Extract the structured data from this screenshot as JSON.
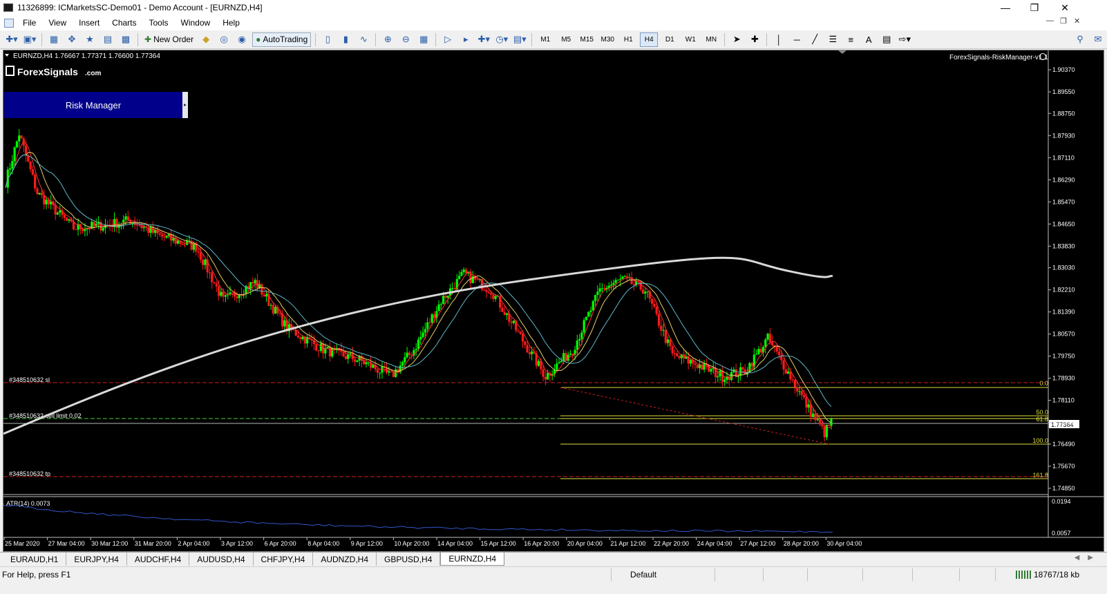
{
  "window": {
    "title": "11326899: ICMarketsSC-Demo01 - Demo Account - [EURNZD,H4]"
  },
  "menu": [
    "File",
    "View",
    "Insert",
    "Charts",
    "Tools",
    "Window",
    "Help"
  ],
  "toolbar": {
    "new_order": "New Order",
    "autotrading": "AutoTrading",
    "timeframes": [
      "M1",
      "M5",
      "M15",
      "M30",
      "H1",
      "H4",
      "D1",
      "W1",
      "MN"
    ],
    "active_timeframe": "H4"
  },
  "chart": {
    "header": "EURNZD,H4  1.76667 1.77371 1.76600 1.77364",
    "logo_text": "ForexSignals",
    "logo_suffix": ".com",
    "risk_manager_label": "Risk Manager",
    "ea_label": "ForexSignals-RiskManager-v1.1",
    "current_price": "1.77364",
    "price_labels": [
      "1.90370",
      "1.89550",
      "1.88750",
      "1.87930",
      "1.87110",
      "1.86290",
      "1.85470",
      "1.84650",
      "1.83830",
      "1.83030",
      "1.82210",
      "1.81390",
      "1.80570",
      "1.79750",
      "1.78930",
      "1.78110",
      "1.77290",
      "1.76490",
      "1.75670",
      "1.74850"
    ],
    "time_labels": [
      "25 Mar 2020",
      "27 Mar 04:00",
      "30 Mar 12:00",
      "31 Mar 20:00",
      "2 Apr 04:00",
      "3 Apr 12:00",
      "6 Apr 20:00",
      "8 Apr 04:00",
      "9 Apr 12:00",
      "10 Apr 20:00",
      "14 Apr 04:00",
      "15 Apr 12:00",
      "16 Apr 20:00",
      "20 Apr 04:00",
      "21 Apr 12:00",
      "22 Apr 20:00",
      "24 Apr 04:00",
      "27 Apr 12:00",
      "28 Apr 20:00",
      "30 Apr 04:00"
    ],
    "order_lines": {
      "sl": "#348510632 sl",
      "sell_limit": "#348510632 sell limit 0.02",
      "tp": "#348510632 tp"
    },
    "fib_labels": [
      "0.0",
      "50.0",
      "61.8",
      "100.0",
      "161.8"
    ],
    "atr_label": "ATR(14) 0.0073",
    "atr_scale": [
      "0.0194",
      "0.0057"
    ]
  },
  "tabs": [
    "EURAUD,H1",
    "EURJPY,H4",
    "AUDCHF,H4",
    "AUDUSD,H4",
    "CHFJPY,H4",
    "AUDNZD,H4",
    "GBPUSD,H4",
    "EURNZD,H4"
  ],
  "active_tab": "EURNZD,H4",
  "status": {
    "help": "For Help, press F1",
    "profile": "Default",
    "traffic": "18767/18 kb"
  },
  "colors": {
    "bull": "#00ff00",
    "bear": "#ff1a1a",
    "ma_long": "#d9d9d9",
    "ma_fast": "#ff3333",
    "ma_mid": "#e8d06a",
    "ma_slow": "#5fb8c8",
    "order_line": "#d02020",
    "fib": "#e0e040",
    "atr": "#3355cc",
    "risk_panel": "#00008b"
  }
}
